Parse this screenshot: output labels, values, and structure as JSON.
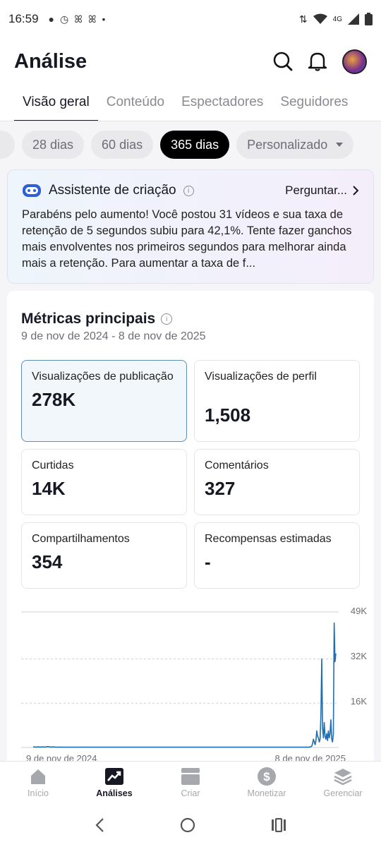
{
  "status_bar": {
    "time": "16:59",
    "network": "4G"
  },
  "header": {
    "title": "Análise"
  },
  "tabs": [
    "Visão geral",
    "Conteúdo",
    "Espectadores",
    "Seguidores"
  ],
  "chips": [
    "28 dias",
    "60 dias",
    "365 dias",
    "Personalizado"
  ],
  "assistant": {
    "title": "Assistente de criação",
    "ask_label": "Perguntar...",
    "message": "Parabéns pelo aumento! Você postou 31 vídeos e sua taxa de retenção de 5 segundos subiu para 42,1%. Tente fazer ganchos mais envolventes nos primeiros segundos para melhorar ainda mais a retenção. Para aumentar a taxa de f..."
  },
  "metrics": {
    "title": "Métricas principais",
    "date_range": "9 de nov de 2024 - 8 de nov de 2025",
    "items": [
      {
        "label": "Visualizações de publicação",
        "value": "278K"
      },
      {
        "label": "Visualizações de perfil",
        "value": "1,508"
      },
      {
        "label": "Curtidas",
        "value": "14K"
      },
      {
        "label": "Comentários",
        "value": "327"
      },
      {
        "label": "Compartilhamentos",
        "value": "354"
      },
      {
        "label": "Recompensas estimadas",
        "value": "-"
      }
    ]
  },
  "chart_data": {
    "type": "line",
    "y_ticks": [
      "49K",
      "32K",
      "16K"
    ],
    "x_labels": [
      "9 de nov de 2024",
      "8 de nov de 2025"
    ],
    "ylim": [
      0,
      49000
    ],
    "color": "#1f6fb2",
    "series": [
      {
        "values": [
          200,
          200,
          200,
          150,
          150,
          200,
          200,
          200,
          150,
          150,
          200,
          200,
          200,
          150,
          150,
          200,
          250,
          300,
          300,
          250,
          200,
          200,
          150,
          150,
          200,
          200,
          150,
          150,
          100,
          100,
          100,
          100,
          150,
          150,
          100,
          100,
          100,
          100,
          100,
          100,
          100,
          100,
          100,
          100,
          100,
          100,
          100,
          100,
          100,
          100,
          100,
          100,
          100,
          100,
          100,
          100,
          100,
          100,
          100,
          100,
          100,
          100,
          100,
          100,
          100,
          100,
          100,
          100,
          100,
          100,
          100,
          100,
          100,
          100,
          100,
          100,
          100,
          100,
          100,
          100,
          100,
          100,
          100,
          100,
          100,
          100,
          100,
          100,
          100,
          100,
          100,
          100,
          100,
          100,
          100,
          100,
          100,
          100,
          100,
          100,
          100,
          100,
          100,
          100,
          100,
          100,
          100,
          100,
          100,
          100,
          100,
          100,
          100,
          100,
          100,
          100,
          100,
          100,
          100,
          100,
          100,
          100,
          100,
          100,
          100,
          100,
          100,
          100,
          100,
          100,
          100,
          100,
          100,
          100,
          100,
          100,
          100,
          100,
          100,
          100,
          100,
          100,
          100,
          100,
          100,
          100,
          100,
          100,
          100,
          100,
          100,
          100,
          100,
          100,
          100,
          100,
          100,
          100,
          100,
          100,
          100,
          100,
          100,
          100,
          100,
          100,
          100,
          100,
          100,
          100,
          100,
          100,
          100,
          100,
          100,
          100,
          100,
          100,
          100,
          100,
          100,
          100,
          100,
          100,
          100,
          100,
          100,
          100,
          100,
          100,
          100,
          100,
          100,
          100,
          100,
          100,
          100,
          100,
          100,
          100,
          100,
          100,
          100,
          100,
          100,
          100,
          100,
          100,
          100,
          100,
          100,
          100,
          100,
          100,
          100,
          100,
          100,
          100,
          100,
          100,
          100,
          100,
          100,
          100,
          100,
          100,
          100,
          100,
          100,
          100,
          100,
          100,
          100,
          100,
          100,
          100,
          100,
          100,
          100,
          100,
          100,
          100,
          100,
          100,
          100,
          100,
          100,
          100,
          100,
          100,
          100,
          100,
          100,
          100,
          100,
          100,
          100,
          100,
          100,
          100,
          100,
          100,
          100,
          100,
          100,
          100,
          100,
          100,
          100,
          100,
          100,
          100,
          100,
          100,
          100,
          100,
          100,
          100,
          100,
          100,
          100,
          100,
          100,
          100,
          100,
          100,
          100,
          100,
          100,
          100,
          100,
          100,
          100,
          100,
          100,
          100,
          100,
          100,
          100,
          100,
          100,
          100,
          100,
          100,
          100,
          100,
          100,
          100,
          100,
          100,
          100,
          100,
          100,
          100,
          100,
          100,
          100,
          100,
          100,
          100,
          100,
          100,
          100,
          100,
          100,
          100,
          100,
          100,
          100,
          100,
          100,
          100,
          100,
          150,
          200,
          300,
          500,
          1500,
          3000,
          2000,
          1000,
          2500,
          6000,
          4000,
          3500,
          2000,
          3000,
          12000,
          32000,
          7000,
          3500,
          9000,
          4000,
          3000,
          5000,
          2500,
          6000,
          3500,
          5000,
          10000,
          3000,
          2000,
          5000,
          45000,
          31000,
          34000
        ]
      }
    ]
  },
  "bottom_nav": [
    "Início",
    "Análises",
    "Criar",
    "Monetizar",
    "Gerenciar"
  ]
}
